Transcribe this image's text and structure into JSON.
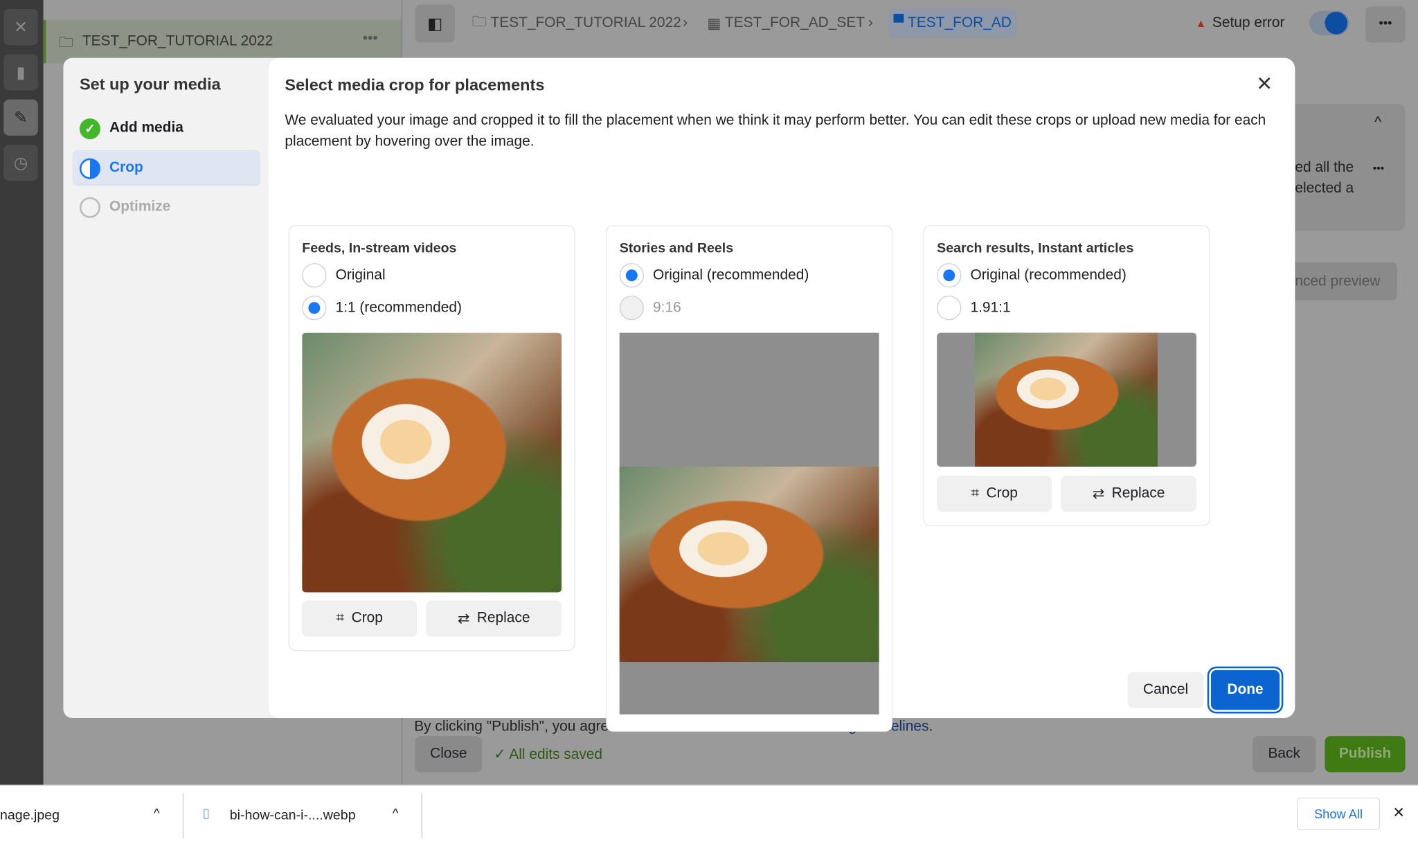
{
  "sidebar_rail": {
    "icons": [
      "close-icon",
      "chart-icon",
      "pencil-icon",
      "clock-icon"
    ]
  },
  "left_pane": {
    "campaign": "TEST_FOR_TUTORIAL 2022"
  },
  "header": {
    "breadcrumbs": [
      "TEST_FOR_TUTORIAL 2022",
      "TEST_FOR_AD_SET",
      "TEST_FOR_AD"
    ],
    "status": "Setup error",
    "toggle_on": true
  },
  "background": {
    "snippet1": "ed all the",
    "snippet2": "elected a",
    "preview_btn": "nced preview",
    "terms_prefix": "By clicking \"Publish\", you agree to Facebook's ",
    "terms_link": "Terms and Advertising Guidelines",
    "terms_suffix": ".",
    "close": "Close",
    "saved": "All edits saved",
    "back": "Back",
    "publish": "Publish"
  },
  "wizard": {
    "title": "Set up your media",
    "steps": [
      {
        "label": "Add media",
        "state": "done"
      },
      {
        "label": "Crop",
        "state": "active"
      },
      {
        "label": "Optimize",
        "state": "pending"
      }
    ]
  },
  "modal": {
    "title": "Select media crop for placements",
    "description": "We evaluated your image and cropped it to fill the placement when we think it may perform better. You can edit these crops or upload new media for each placement by hovering over the image.",
    "cards": [
      {
        "title": "Feeds, In-stream videos",
        "options": [
          {
            "label": "Original",
            "selected": false
          },
          {
            "label": "1:1 (recommended)",
            "selected": true
          }
        ],
        "crop": "Crop",
        "replace": "Replace"
      },
      {
        "title": "Stories and Reels",
        "options": [
          {
            "label": "Original (recommended)",
            "selected": true
          },
          {
            "label": "9:16",
            "selected": false,
            "disabled": true
          }
        ]
      },
      {
        "title": "Search results, Instant articles",
        "options": [
          {
            "label": "Original (recommended)",
            "selected": true
          },
          {
            "label": "1.91:1",
            "selected": false
          }
        ],
        "crop": "Crop",
        "replace": "Replace"
      }
    ],
    "cancel": "Cancel",
    "done": "Done"
  },
  "downloads": {
    "items": [
      "nage.jpeg",
      "bi-how-can-i-....webp"
    ],
    "show_all": "Show All"
  },
  "colors": {
    "accent": "#1877f2",
    "done_button": "#0b64d0",
    "publish": "#3f7a12",
    "success": "#42b72a",
    "error": "#c0392b"
  }
}
